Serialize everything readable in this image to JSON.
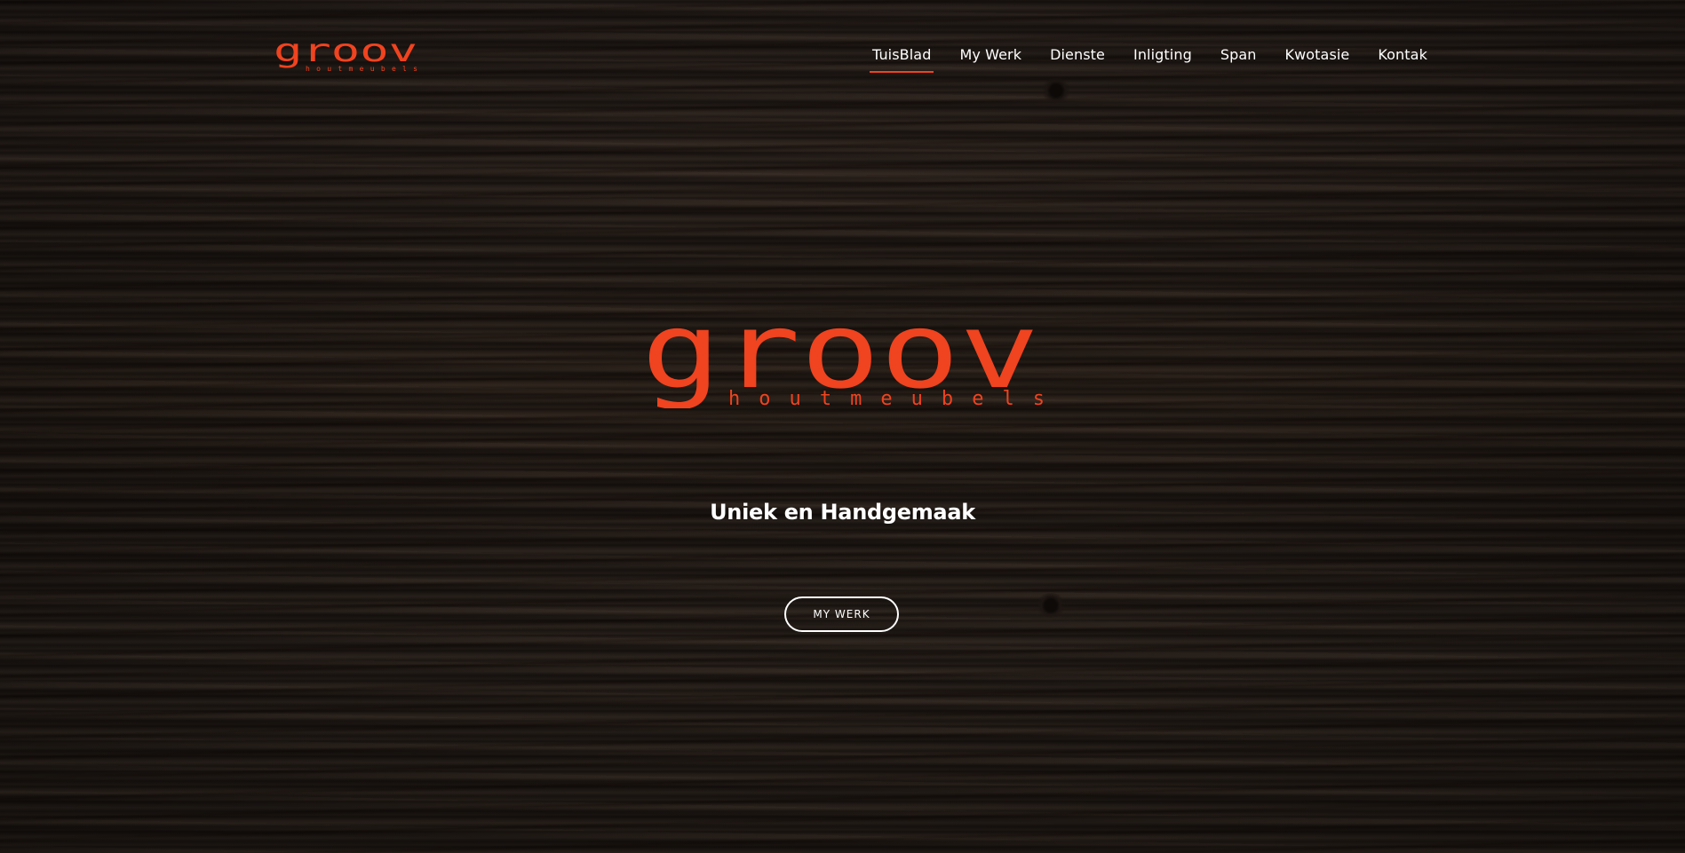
{
  "brand": {
    "name": "groov",
    "subtitle": "houtmeubels",
    "accent_color": "#f0431f"
  },
  "nav": {
    "items": [
      {
        "label": "TuisBlad",
        "active": true
      },
      {
        "label": "My Werk",
        "active": false
      },
      {
        "label": "Dienste",
        "active": false
      },
      {
        "label": "Inligting",
        "active": false
      },
      {
        "label": "Span",
        "active": false
      },
      {
        "label": "Kwotasie",
        "active": false
      },
      {
        "label": "Kontak",
        "active": false
      }
    ]
  },
  "hero": {
    "tagline": "Uniek en Handgemaak",
    "cta_label": "MY WERK",
    "background": "dark wood texture"
  }
}
